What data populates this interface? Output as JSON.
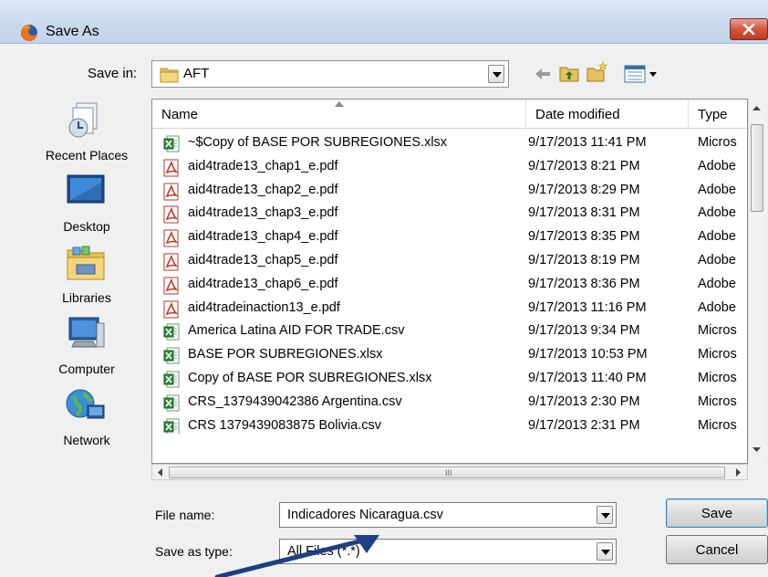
{
  "window": {
    "title": "Save As"
  },
  "save_in": {
    "label": "Save in:",
    "folder": "AFT"
  },
  "places": [
    {
      "label": "Recent Places",
      "icon": "recent-places-icon"
    },
    {
      "label": "Desktop",
      "icon": "desktop-icon"
    },
    {
      "label": "Libraries",
      "icon": "libraries-icon"
    },
    {
      "label": "Computer",
      "icon": "computer-icon"
    },
    {
      "label": "Network",
      "icon": "network-icon"
    }
  ],
  "columns": {
    "name": "Name",
    "date": "Date modified",
    "type": "Type"
  },
  "files": [
    {
      "name": "~$Copy of BASE POR SUBREGIONES.xlsx",
      "date": "9/17/2013 11:41 PM",
      "type": "Micros",
      "icon": "excel"
    },
    {
      "name": "aid4trade13_chap1_e.pdf",
      "date": "9/17/2013 8:21 PM",
      "type": "Adobe",
      "icon": "pdf"
    },
    {
      "name": "aid4trade13_chap2_e.pdf",
      "date": "9/17/2013 8:29 PM",
      "type": "Adobe",
      "icon": "pdf"
    },
    {
      "name": "aid4trade13_chap3_e.pdf",
      "date": "9/17/2013 8:31 PM",
      "type": "Adobe",
      "icon": "pdf"
    },
    {
      "name": "aid4trade13_chap4_e.pdf",
      "date": "9/17/2013 8:35 PM",
      "type": "Adobe",
      "icon": "pdf"
    },
    {
      "name": "aid4trade13_chap5_e.pdf",
      "date": "9/17/2013 8:19 PM",
      "type": "Adobe",
      "icon": "pdf"
    },
    {
      "name": "aid4trade13_chap6_e.pdf",
      "date": "9/17/2013 8:36 PM",
      "type": "Adobe",
      "icon": "pdf"
    },
    {
      "name": "aid4tradeinaction13_e.pdf",
      "date": "9/17/2013 11:16 PM",
      "type": "Adobe",
      "icon": "pdf"
    },
    {
      "name": "America Latina AID FOR TRADE.csv",
      "date": "9/17/2013 9:34 PM",
      "type": "Micros",
      "icon": "excel"
    },
    {
      "name": "BASE POR SUBREGIONES.xlsx",
      "date": "9/17/2013 10:53 PM",
      "type": "Micros",
      "icon": "excel"
    },
    {
      "name": "Copy of BASE POR SUBREGIONES.xlsx",
      "date": "9/17/2013 11:40 PM",
      "type": "Micros",
      "icon": "excel"
    },
    {
      "name": "CRS_1379439042386 Argentina.csv",
      "date": "9/17/2013 2:30 PM",
      "type": "Micros",
      "icon": "excel"
    },
    {
      "name": "CRS 1379439083875 Bolivia.csv",
      "date": "9/17/2013 2:31 PM",
      "type": "Micros",
      "icon": "excel"
    }
  ],
  "scrollbar_grip": "III",
  "file_name": {
    "label": "File name:",
    "value": "Indicadores Nicaragua.csv"
  },
  "save_as_type": {
    "label": "Save as type:",
    "value": "All Files (*.*)"
  },
  "buttons": {
    "save": "Save",
    "cancel": "Cancel"
  },
  "colors": {
    "title_bar": "#c9d9ee",
    "close_button": "#c94a33",
    "annotation_arrow": "#1f3f86",
    "pdf_icon": "#c0392b",
    "excel_icon": "#2e8b3a"
  }
}
